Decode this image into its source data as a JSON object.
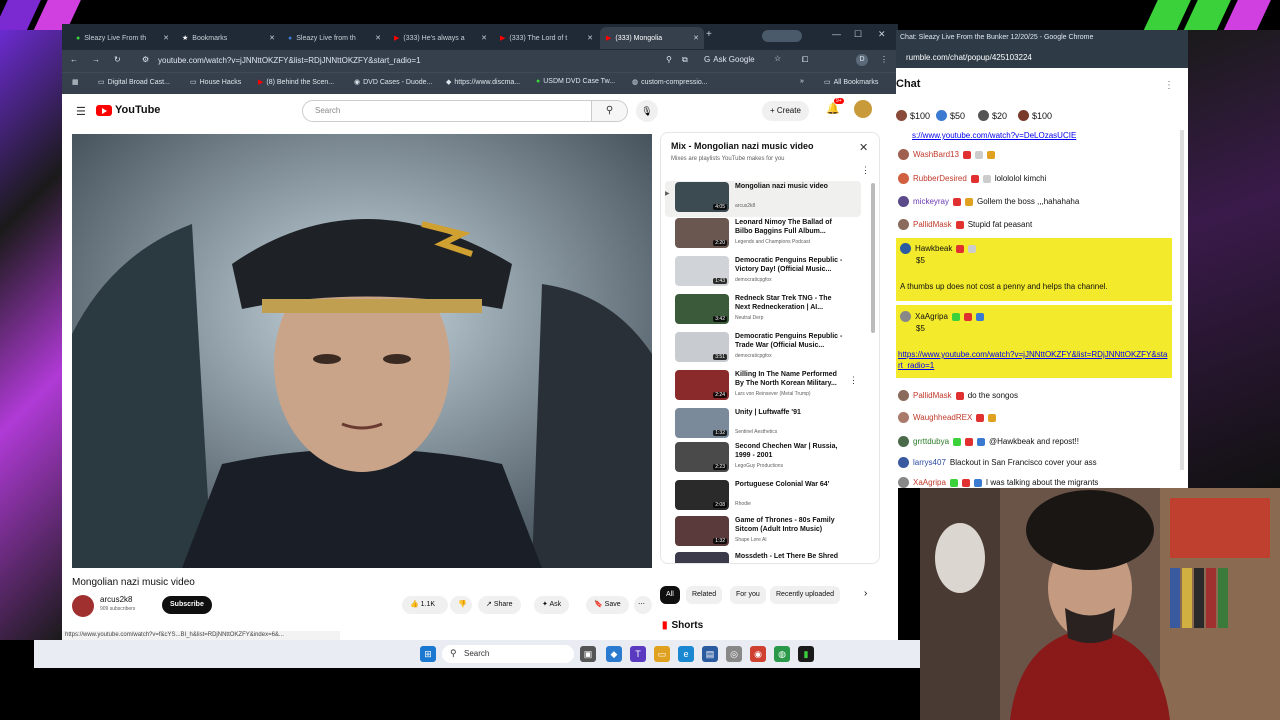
{
  "browser": {
    "tabs": [
      {
        "label": "Sleazy Live From th",
        "active": false
      },
      {
        "label": "Bookmarks",
        "active": false
      },
      {
        "label": "Sleazy Live from th",
        "active": false
      },
      {
        "label": "(333) He's always a",
        "active": false
      },
      {
        "label": "(333) The Lord of t",
        "active": false
      },
      {
        "label": "(333) Mongolia",
        "active": true
      }
    ],
    "url": "youtube.com/watch?v=jJNNttOKZFY&list=RDjJNNttOKZFY&start_radio=1",
    "ask_google": "Ask Google",
    "bookmarks": [
      "Digital Broad Cast...",
      "House Hacks",
      "(8) Behind the Scen...",
      "DVD Cases - Duode...",
      "https://www.discma...",
      "USDM DVD Case Tw...",
      "custom-compressio..."
    ],
    "all_bookmarks": "All Bookmarks",
    "status_url": "https://www.youtube.com/watch?v=f&cYS...BI_h&list=RDjNNttOKZFY&index=6&..."
  },
  "youtube": {
    "logo": "YouTube",
    "search_placeholder": "Search",
    "create": "Create",
    "notif_count": "9+",
    "video_title": "Mongolian nazi music video",
    "channel": "arcus2k8",
    "subscribers": "909 subscribers",
    "subscribe": "Subscribe",
    "likes": "1.1K",
    "share": "Share",
    "ask": "Ask",
    "save": "Save",
    "mix_title": "Mix - Mongolian nazi music video",
    "mix_sub": "Mixes are playlists YouTube makes for you",
    "playlist": [
      {
        "title": "Mongolian nazi music video",
        "channel": "arcus2k8",
        "duration": "4:05",
        "color": "#3c4a52"
      },
      {
        "title": "Leonard Nimoy The Ballad of Bilbo Baggins Full Album...",
        "channel": "Legends and Champions Podcast",
        "duration": "2:20",
        "color": "#6a5850"
      },
      {
        "title": "Democratic Penguins Republic - Victory Day! (Official Music...",
        "channel": "democraticpgfox",
        "duration": "1:43",
        "color": "#d0d4d8"
      },
      {
        "title": "Redneck Star Trek TNG - The Next Redneckeration | AI...",
        "channel": "Neutral Derp",
        "duration": "3:42",
        "color": "#3a5a3a"
      },
      {
        "title": "Democratic Penguins Republic - Trade War (Official Music...",
        "channel": "democraticpgfox",
        "duration": "3:51",
        "color": "#c8ccd0"
      },
      {
        "title": "Killing In The Name Performed By The North Korean Military...",
        "channel": "Lars von Reinsever (Metal Trump)",
        "duration": "2:24",
        "color": "#8a2a2a"
      },
      {
        "title": "Unity | Luftwaffe '91",
        "channel": "Sentinel Aesthetics",
        "duration": "1:32",
        "color": "#7a8a9a"
      },
      {
        "title": "Second Chechen War | Russia, 1999 - 2001",
        "channel": "LegoGuy Productions",
        "duration": "2:23",
        "color": "#4a4a4a"
      },
      {
        "title": "Portuguese Colonial War 64'",
        "channel": "Rhodie",
        "duration": "2:08",
        "color": "#2a2a2a"
      },
      {
        "title": "Game of Thrones - 80s Family Sitcom (Adult Intro Music)",
        "channel": "Shape Lore AI",
        "duration": "1:32",
        "color": "#5a3a3a"
      },
      {
        "title": "Mossdeth - Let There Be Shred",
        "channel": "",
        "duration": "",
        "color": "#3a3a4a"
      }
    ],
    "chips": [
      "All",
      "Related",
      "For you",
      "Recently uploaded"
    ],
    "shorts": "Shorts"
  },
  "taskbar": {
    "search": "Search"
  },
  "chat": {
    "window_title": "Chat: Sleazy Live From the Bunker 12/20/25 - Google Chrome",
    "url": "rumble.com/chat/popup/425103224",
    "heading": "Chat",
    "tips": [
      "$100",
      "$50",
      "$20",
      "$100"
    ],
    "first_link": "s://www.youtube.com/watch?v=DeLOzasUCIE",
    "messages": [
      {
        "user": "WashBard13",
        "text": "",
        "color": "#c0392b"
      },
      {
        "user": "RubberDesired",
        "text": "lolololol kimchi",
        "color": "#c0392b"
      },
      {
        "user": "mickeyray",
        "text": "Gollem the boss ,,,hahahaha",
        "color": "#6a3ab0"
      },
      {
        "user": "PallidMask",
        "text": "Stupid fat peasant",
        "color": "#c0392b"
      }
    ],
    "super1": {
      "user": "Hawkbeak",
      "amount": "$5",
      "text": "A thumbs up does not cost a penny and helps tha channel."
    },
    "super2": {
      "user": "XaAgripa",
      "amount": "$5",
      "link": "https://www.youtube.com/watch?v=jJNNttOKZFY&list=RDjJNNttOKZFY&start_radio=1"
    },
    "messages2": [
      {
        "user": "PallidMask",
        "text": "do the songos",
        "color": "#c0392b"
      },
      {
        "user": "WaughheadREX",
        "text": "",
        "color": "#c0392b"
      },
      {
        "user": "grrttdubya",
        "text": "@Hawkbeak and repost!!",
        "color": "#2a7a2a"
      },
      {
        "user": "larrys407",
        "text": "Blackout in San Francisco cover your ass",
        "color": "#2a4aa0"
      },
      {
        "user": "XaAgripa",
        "text": "I was talking about the migrants",
        "color": "#c0392b"
      }
    ]
  },
  "colors": {
    "youtube_red": "#ff0000",
    "superchat_yellow": "#f2ea2b",
    "chrome_dark": "#35404c"
  }
}
